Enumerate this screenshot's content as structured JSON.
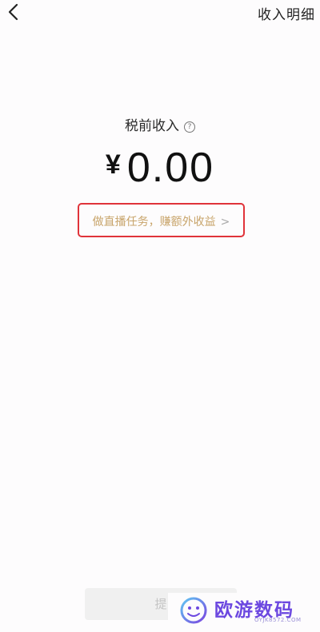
{
  "header": {
    "back_icon": "chevron-left-icon",
    "right_link": "收入明细"
  },
  "earnings": {
    "label": "税前收入",
    "help_icon_glyph": "?",
    "currency": "¥",
    "amount": "0.00"
  },
  "promo": {
    "text": "做直播任务，赚额外收益",
    "chevron": ">"
  },
  "bottom_button": {
    "label": "提"
  },
  "watermark": {
    "text": "欧游数码",
    "domain": "OYJK8572.COM"
  },
  "colors": {
    "background": "#fdfcfd",
    "promo_text": "#c8a46a",
    "highlight_border": "#e0333a",
    "watermark": "#6c48e0"
  }
}
